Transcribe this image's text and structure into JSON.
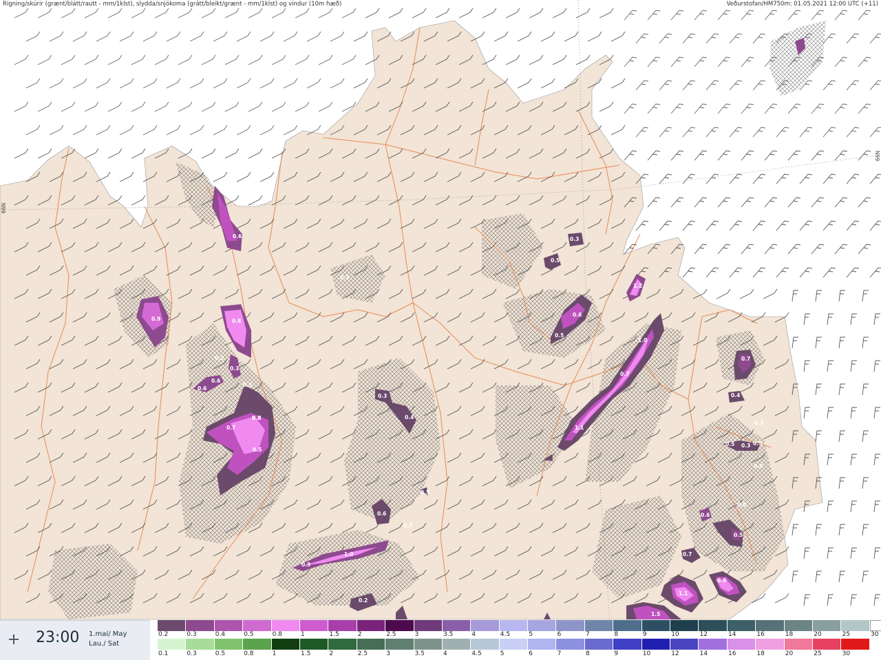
{
  "header": {
    "left": "Rigning/skúrir (grænt/blátt/rautt - mm/1klst), slydda/snjókoma (grátt/bleikt/grænt - mm/1klst) og vindur (10m hæð)",
    "right": "Veðurstofan/HM750m: 01.05.2021 12:00 UTC (+11)"
  },
  "grid_labels": {
    "left": "66N",
    "right": "66N"
  },
  "time": "23:00",
  "date_line1": "1.maí/ May",
  "date_line2": "Lau./ Sat",
  "contour_labels": [
    "0.6",
    "0.8",
    "0.8",
    "0.9",
    "0.2",
    "0.3",
    "0.5",
    "0.6",
    "0.6",
    "0.8",
    "0.7",
    "0.5",
    "0.3",
    "0.4",
    "0.5",
    "0.6",
    "1.0",
    "0.3",
    "0.9",
    "0.2",
    "0.6",
    "0.5",
    "0.3",
    "0.5",
    "0.3",
    "0.4",
    "0.7",
    "1.1",
    "1.0",
    "1.2",
    "0.5",
    "0.7",
    "0.4",
    "0.3",
    "0.3",
    "0.5",
    "0.6",
    "0.6",
    "0.5",
    "0.7",
    "0.9",
    "1.1",
    "1.5"
  ],
  "legend": {
    "row1": {
      "labels": [
        "0.2",
        "0.3",
        "0.4",
        "0.5",
        "0.8",
        "1",
        "1.5",
        "2",
        "2.5",
        "3",
        "3.5",
        "4",
        "4.5",
        "5",
        "6",
        "7",
        "8",
        "9",
        "10",
        "12",
        "14",
        "16",
        "18",
        "20",
        "25",
        "30"
      ],
      "colors": [
        "#6b4a6b",
        "#8e4a8e",
        "#ad55ad",
        "#cf6acf",
        "#f08af0",
        "#cf5ccf",
        "#a83ea8",
        "#7a237a",
        "#4d0a4d",
        "#6e3a7a",
        "#8a5ea8",
        "#a79ad9",
        "#b8b8f0",
        "#a5a5e0",
        "#8f94c8",
        "#6f86a8",
        "#4e6e8c",
        "#2e4f63",
        "#1f3f4c",
        "#2c4f58",
        "#3d5f66",
        "#577276",
        "#6b8486",
        "#8aa0a0",
        "#b4c6c6",
        "#ffffff"
      ]
    },
    "row2": {
      "labels": [
        "0.1",
        "0.3",
        "0.5",
        "0.8",
        "1",
        "1.5",
        "2",
        "2.5",
        "3",
        "3.5",
        "4",
        "4.5",
        "5",
        "6",
        "7",
        "8",
        "9",
        "10",
        "12",
        "14",
        "16",
        "18",
        "20",
        "25",
        "30"
      ],
      "colors": [
        "#d4f5d0",
        "#a8dc9a",
        "#80c46e",
        "#5aa44e",
        "#113f11",
        "#1e5a25",
        "#2f6b3c",
        "#466e56",
        "#5f7f70",
        "#7d948c",
        "#a0b0b0",
        "#b7c8d8",
        "#c9cff5",
        "#b0b5ef",
        "#8e90e0",
        "#6a6ad0",
        "#4040c4",
        "#2020b0",
        "#4a44c0",
        "#a070e0",
        "#d890e8",
        "#f0a0e0",
        "#f07898",
        "#e84060",
        "#e01818"
      ]
    }
  },
  "colors": {
    "land": "#f2e4d6",
    "sea": "#ffffff",
    "roads": "#e88a55",
    "precip_light": "#8e5a8e",
    "precip_mid": "#c052c0",
    "precip_high": "#f28cf2"
  }
}
